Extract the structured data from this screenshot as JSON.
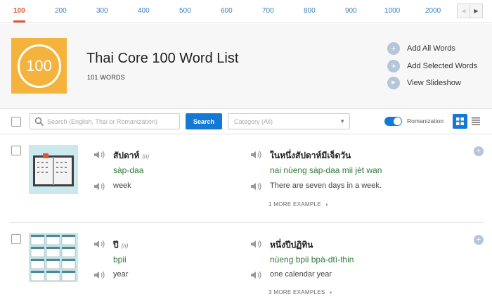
{
  "pagination": {
    "tabs": [
      "100",
      "200",
      "300",
      "400",
      "500",
      "600",
      "700",
      "800",
      "900",
      "1000",
      "2000"
    ],
    "active_tab": "100",
    "prev_icon": "chevron-left-icon",
    "next_icon": "chevron-right-icon"
  },
  "header": {
    "icon_text": "100",
    "title": "Thai Core 100 Word List",
    "word_count": "101 WORDS",
    "actions": [
      {
        "label": "Add All Words",
        "icon": "plus-icon"
      },
      {
        "label": "Add Selected Words",
        "icon": "plus-icon"
      },
      {
        "label": "View Slideshow",
        "icon": "play-icon"
      }
    ]
  },
  "toolbar": {
    "search_placeholder": "Search (English, Thai or Romanization)",
    "search_button": "Search",
    "category_placeholder": "Category (All)",
    "romanization_label": "Romanization",
    "romanization_on": true
  },
  "words": [
    {
      "thai": "สัปดาห์",
      "pos": "(n)",
      "romanization": "sàp-daa",
      "english": "week",
      "example_thai": "ในหนึ่งสัปดาห์มีเจ็ดวัน",
      "example_romanization": "nai nùeng sàp-daa mii jèt wan",
      "example_english": "There are seven days in a week.",
      "more_examples": "1 MORE EXAMPLE",
      "image": "calendar-week-image"
    },
    {
      "thai": "ปี",
      "pos": "(n)",
      "romanization": "bpii",
      "english": "year",
      "example_thai": "หนึ่งปีปฏิทิน",
      "example_romanization": "nùeng bpii bpà-dtì-thin",
      "example_english": "one calendar year",
      "more_examples": "3 MORE EXAMPLES",
      "image": "calendar-year-image"
    }
  ],
  "colors": {
    "accent_orange": "#e4572e",
    "link_blue": "#3a7fc1",
    "primary_blue": "#1479d4",
    "list_icon_bg": "#f4b33c",
    "romanization_green": "#2f7b3a",
    "thumb_bg": "#cbe8ec"
  }
}
